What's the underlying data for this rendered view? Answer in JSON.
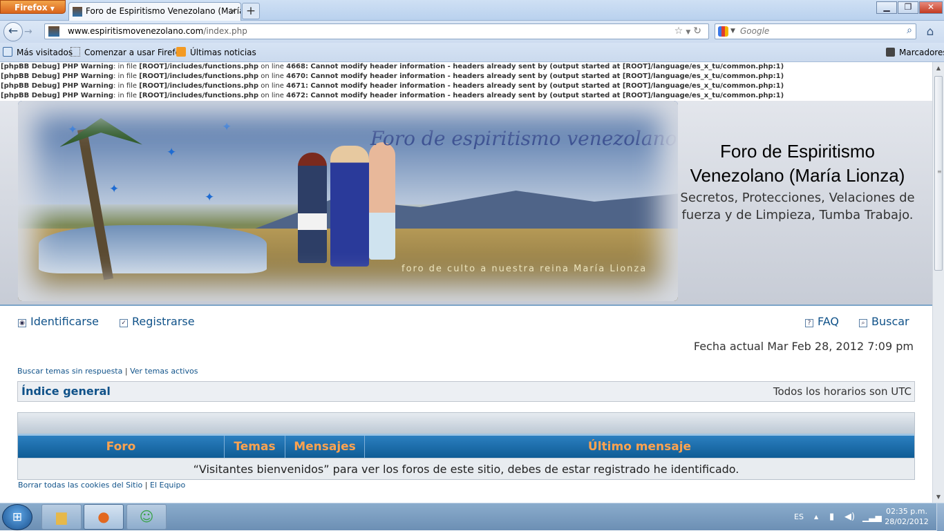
{
  "browser": {
    "app_button": "Firefox",
    "tab_title": "Foro de Espiritismo Venezolano (María Li...",
    "url_host": "www.espiritismovenezolano.com",
    "url_path": "/index.php",
    "search_placeholder": "Google",
    "bookmarks": [
      "Más visitados",
      "Comenzar a usar Firefox",
      "Últimas noticias"
    ],
    "bookmarks_menu": "Marcadores"
  },
  "debug": [
    {
      "tag": "[phpBB Debug] PHP Warning",
      "a": ": in file ",
      "file": "[ROOT]/includes/functions.php",
      "b": " on line ",
      "line": "4668",
      "msg": ": Cannot modify header information - headers already sent by (output started at [ROOT]/language/es_x_tu/common.php:1)"
    },
    {
      "tag": "[phpBB Debug] PHP Warning",
      "a": ": in file ",
      "file": "[ROOT]/includes/functions.php",
      "b": " on line ",
      "line": "4670",
      "msg": ": Cannot modify header information - headers already sent by (output started at [ROOT]/language/es_x_tu/common.php:1)"
    },
    {
      "tag": "[phpBB Debug] PHP Warning",
      "a": ": in file ",
      "file": "[ROOT]/includes/functions.php",
      "b": " on line ",
      "line": "4671",
      "msg": ": Cannot modify header information - headers already sent by (output started at [ROOT]/language/es_x_tu/common.php:1)"
    },
    {
      "tag": "[phpBB Debug] PHP Warning",
      "a": ": in file ",
      "file": "[ROOT]/includes/functions.php",
      "b": " on line ",
      "line": "4672",
      "msg": ": Cannot modify header information - headers already sent by (output started at [ROOT]/language/es_x_tu/common.php:1)"
    }
  ],
  "banner": {
    "title": "Foro de espiritismo venezolano",
    "subtitle": "foro de culto a nuestra reina María Lionza"
  },
  "site": {
    "title": "Foro de Espiritismo Venezolano (María Lionza)",
    "description": "Secretos, Protecciones, Velaciones de fuerza y de Limpieza, Tumba Trabajo."
  },
  "nav": {
    "login": "Identificarse",
    "register": "Registrarse",
    "faq": "FAQ",
    "search": "Buscar"
  },
  "fecha": "Fecha actual Mar Feb 28, 2012 7:09 pm",
  "quick_links": {
    "unanswered": "Buscar temas sin respuesta",
    "separator": "|",
    "active": "Ver temas activos"
  },
  "breadcrumb": {
    "index": "Índice general",
    "timezone": "Todos los horarios son UTC"
  },
  "forum_table": {
    "headers": [
      "Foro",
      "Temas",
      "Mensajes",
      "Último mensaje"
    ],
    "message": "“Visitantes bienvenidos” para ver los foros de este sitio, debes de estar registrado he identificado."
  },
  "footer": {
    "delete_cookies": "Borrar todas las cookies del Sitio",
    "separator": "|",
    "team": "El Equipo"
  },
  "taskbar": {
    "language": "ES",
    "time": "02:35 p.m.",
    "date": "28/02/2012"
  }
}
